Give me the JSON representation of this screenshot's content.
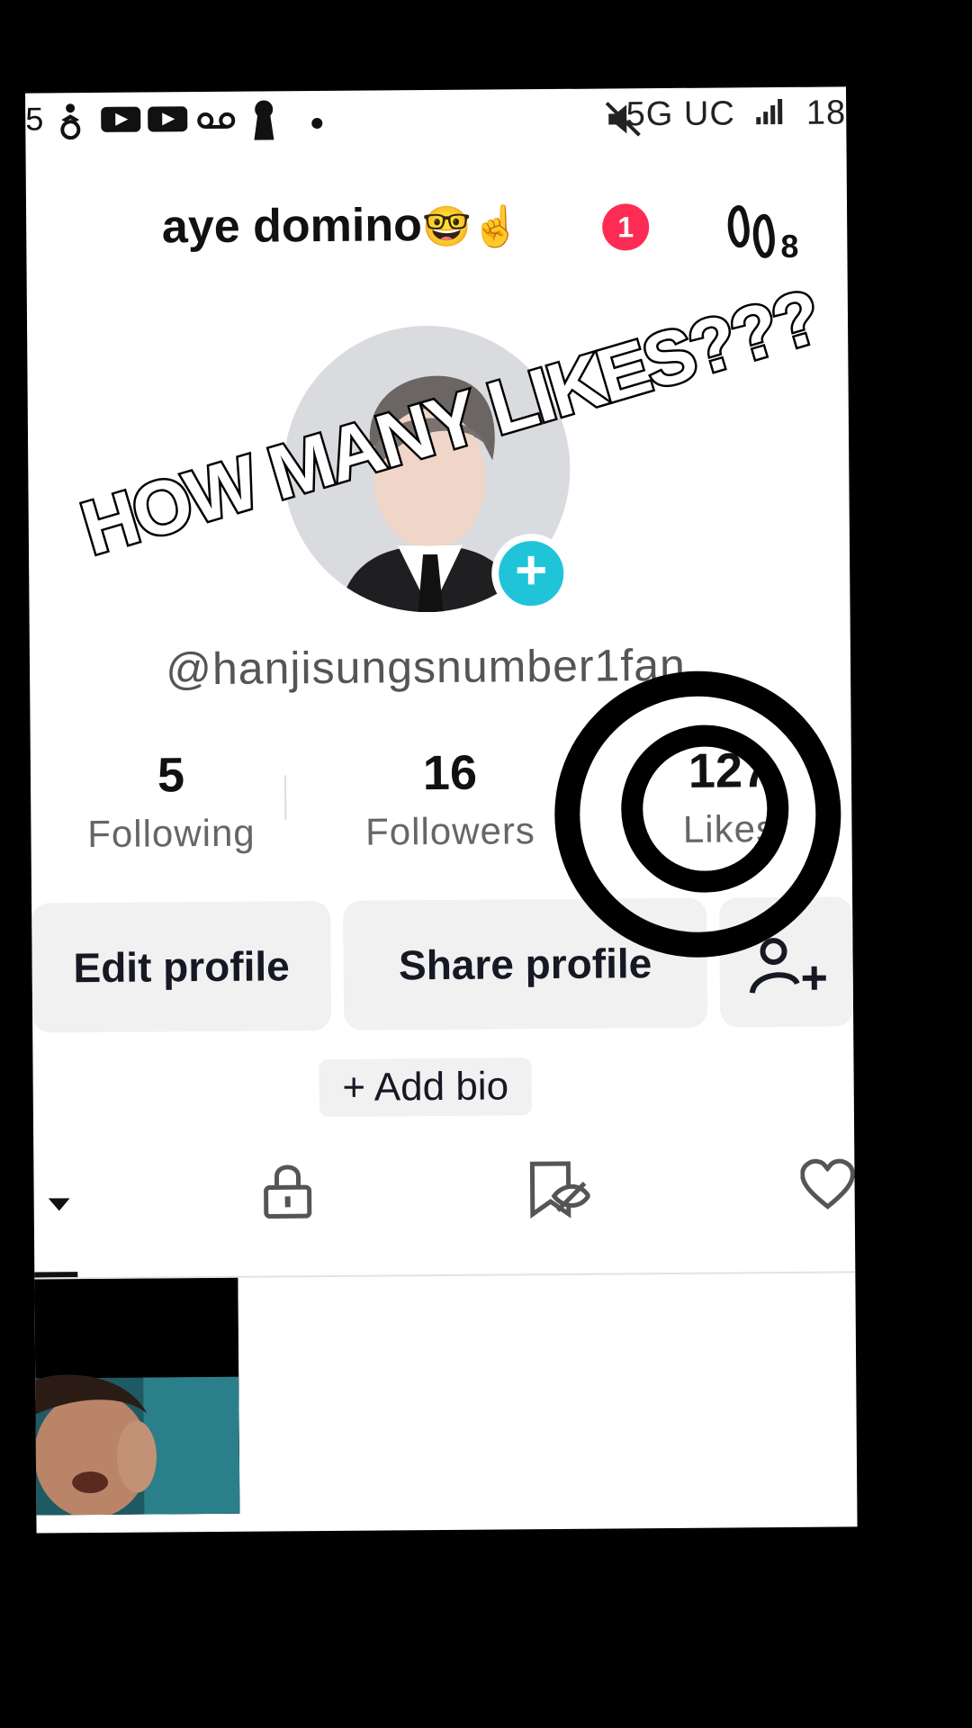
{
  "status_bar": {
    "left_partial": "5",
    "network": "5G UC",
    "time_partial": "18"
  },
  "header": {
    "title": "aye domino",
    "title_emojis": "🤓☝️",
    "notification_count": "1",
    "footprint_count": "8",
    "icons": [
      "footprint-icon"
    ]
  },
  "profile": {
    "username": "@hanjisungsnumber1fan",
    "avatar_add": "+"
  },
  "stats": [
    {
      "value": "5",
      "label": "Following"
    },
    {
      "value": "16",
      "label": "Followers"
    },
    {
      "value": "127",
      "label": "Likes"
    }
  ],
  "actions": {
    "edit_profile": "Edit profile",
    "share_profile": "Share profile",
    "add_friends_icon": "add-user-icon",
    "add_bio": "+ Add bio"
  },
  "tabs": {
    "icons": [
      "videos-tab-icon",
      "lock-icon",
      "hidden-bookmark-icon",
      "liked-heart-icon"
    ]
  },
  "overlay": {
    "caption": "HOW MANY LIKES???"
  },
  "colors": {
    "accent_pink": "#fe2c55",
    "add_button_cyan": "#20c4d8"
  }
}
